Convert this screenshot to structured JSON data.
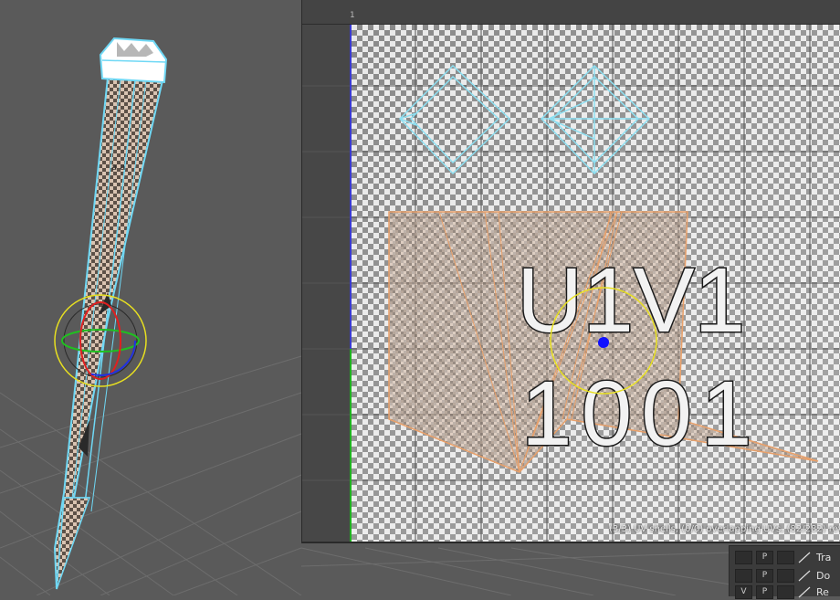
{
  "uv_editor": {
    "ruler_label": "1",
    "status_text": "(3/3) UV shells, (0/0) overlapping UVs, (82/282) reve",
    "tile_label_line1": "U1V1",
    "tile_label_line2": "1001",
    "colors": {
      "checker_light": "#e9e9e9",
      "checker_dark": "#8a8a8a",
      "shell_wire": "#8ee0f2",
      "selected_shell": "#e8a06a",
      "u_axis": "#1fb21f",
      "v_axis": "#3a3ad0",
      "pivot": "#1010ff",
      "manip_ring": "#e8e020"
    }
  },
  "viewport": {
    "colors": {
      "background": "#5a5a5a",
      "grid": "#6c6c6c",
      "wireframe": "#6fd8f5"
    }
  },
  "attribute_strip": {
    "rows": [
      {
        "box1": "",
        "box2": "P",
        "label": "Tra"
      },
      {
        "box1": "",
        "box2": "P",
        "label": "Do"
      },
      {
        "box1": "V",
        "box2": "P",
        "label": "Re"
      }
    ]
  }
}
